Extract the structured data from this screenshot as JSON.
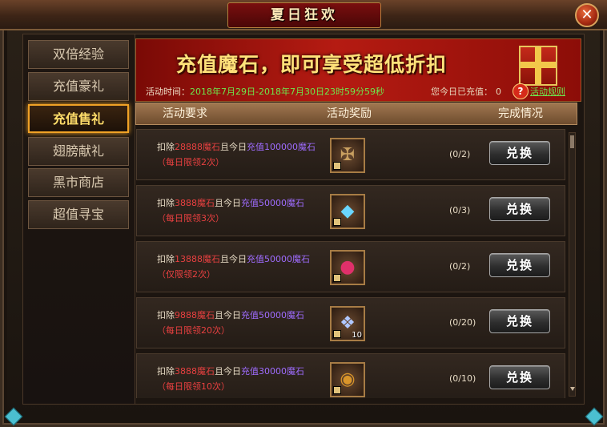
{
  "window": {
    "title": "夏日狂欢",
    "close_label": "✕"
  },
  "tabs": [
    {
      "label": "双倍经验",
      "active": false
    },
    {
      "label": "充值豪礼",
      "active": false
    },
    {
      "label": "充值售礼",
      "active": true
    },
    {
      "label": "翅膀献礼",
      "active": false
    },
    {
      "label": "黑市商店",
      "active": false
    },
    {
      "label": "超值寻宝",
      "active": false
    }
  ],
  "banner": {
    "headline": "充值魔石，即可享受超低折扣",
    "time_label": "活动时间：",
    "time_value": "2018年7月29日-2018年7月30日23时59分59秒",
    "recharge_label": "您今日已充值：",
    "recharge_value": "0",
    "help_icon": "?",
    "rules_label": "活动规则"
  },
  "table": {
    "headers": [
      "活动要求",
      "活动奖励",
      "完成情况"
    ]
  },
  "rows": [
    {
      "deduct_prefix": "扣除",
      "deduct_amount": "28888魔石",
      "middle": "且今日",
      "recharge": "充值100000魔石",
      "limit": "（每日限领2次）",
      "reward_icon": "cross-emblem-icon",
      "reward_glyph": "✠",
      "reward_color": "#c9a060",
      "reward_qty": "",
      "progress": "(0/2)",
      "button": "兑换"
    },
    {
      "deduct_prefix": "扣除",
      "deduct_amount": "3888魔石",
      "middle": "且今日",
      "recharge": "充值50000魔石",
      "limit": "（每日限领3次）",
      "reward_icon": "blue-crystal-icon",
      "reward_glyph": "◆",
      "reward_color": "#6ad6ff",
      "reward_qty": "",
      "progress": "(0/3)",
      "button": "兑换"
    },
    {
      "deduct_prefix": "扣除",
      "deduct_amount": "13888魔石",
      "middle": "且今日",
      "recharge": "充值50000魔石",
      "limit": "（仅限领2次）",
      "reward_icon": "red-orb-icon",
      "reward_glyph": "●",
      "reward_color": "#e0306a",
      "reward_qty": "",
      "progress": "(0/2)",
      "button": "兑换"
    },
    {
      "deduct_prefix": "扣除",
      "deduct_amount": "9888魔石",
      "middle": "且今日",
      "recharge": "充值50000魔石",
      "limit": "（每日限领20次）",
      "reward_icon": "gift-box-icon",
      "reward_glyph": "❖",
      "reward_color": "#b0c8ff",
      "reward_qty": "10",
      "progress": "(0/20)",
      "button": "兑换"
    },
    {
      "deduct_prefix": "扣除",
      "deduct_amount": "3888魔石",
      "middle": "且今日",
      "recharge": "充值30000魔石",
      "limit": "（每日限领10次）",
      "reward_icon": "gold-coin-icon",
      "reward_glyph": "◉",
      "reward_color": "#d9952a",
      "reward_qty": "",
      "progress": "(0/10)",
      "button": "兑换"
    }
  ]
}
